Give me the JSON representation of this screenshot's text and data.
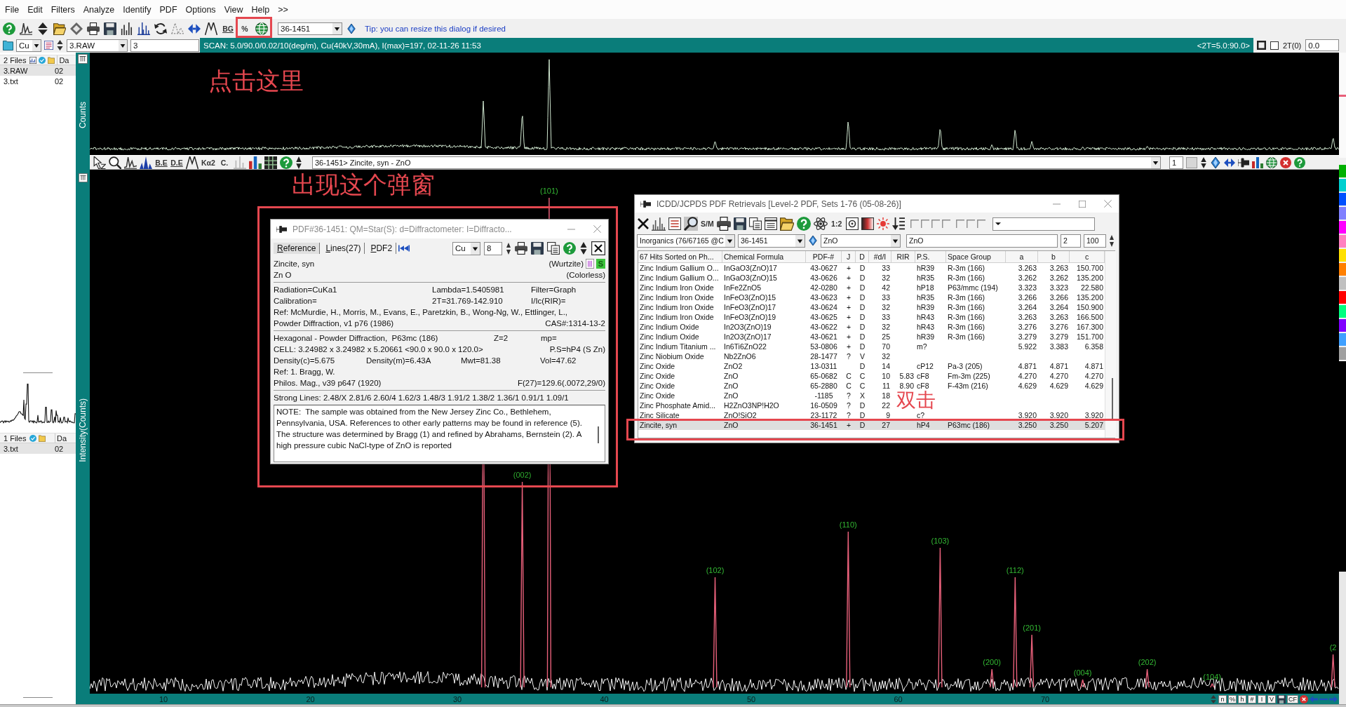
{
  "menu": [
    "File",
    "Edit",
    "Filters",
    "Analyze",
    "Identify",
    "PDF",
    "Options",
    "View",
    "Help",
    ">>"
  ],
  "toolbar": {
    "text_tools": [
      "BG",
      "%"
    ],
    "card_combo": "36-1451",
    "tip": "Tip: you can resize this dialog if desired"
  },
  "scan_bar": {
    "anode": "Cu",
    "file": "3.RAW",
    "field": "3",
    "info": "SCAN: 5.0/90.0/0.02/10(deg/m), Cu(40kV,30mA), I(max)=197, 02-11-26 11:53",
    "range": "<2T=5.0:90.0>",
    "zero_checked": false,
    "zero_label": "2T(0)",
    "zero_value": "0.0"
  },
  "file_panes": [
    {
      "count": "2 Files",
      "column": "Da",
      "files": [
        {
          "name": "3.RAW",
          "date": "02",
          "selected": true
        },
        {
          "name": "3.txt",
          "date": "02",
          "selected": false
        }
      ]
    },
    {
      "count": "1 Files",
      "column": "Da",
      "files": [
        {
          "name": "3.txt",
          "date": "02",
          "selected": true
        }
      ]
    }
  ],
  "plot": {
    "upper_axis": "Counts",
    "lower_axis": "Intensity(Counts)",
    "tool_labels": [
      "B.E",
      "D.E",
      "Kα2",
      "C."
    ],
    "overlay": "36-1451> Zincite, syn - ZnO",
    "overlay_count": "1",
    "peak_labels": [
      "(002)",
      "(101)",
      "(102)",
      "(110)",
      "(103)",
      "(200)",
      "(112)",
      "(201)",
      "(004)",
      "(202)",
      "(104)",
      "(2"
    ],
    "x_ticks": [
      "10",
      "20",
      "30",
      "40",
      "50",
      "60",
      "70"
    ],
    "status_buttons": [
      "n",
      "%",
      "h",
      "#",
      "I",
      "V",
      "CF"
    ]
  },
  "pdf_card": {
    "title": "PDF#36-1451: QM=Star(S): d=Diffractometer: I=Diffracto...",
    "tabs": [
      {
        "label": "Reference",
        "selected": true
      },
      {
        "label": "Lines(27)",
        "selected": false
      },
      {
        "label": "PDF2",
        "selected": false
      }
    ],
    "anode": "Cu",
    "count": "8",
    "name": "Zincite, syn",
    "mineral": "(Wurtzite)",
    "badge": "S",
    "formula": "Zn O",
    "appearance": "(Colorless)",
    "blocks": [
      [
        {
          "kind": "triple",
          "cells": [
            "Radiation=CuKa1",
            "Lambda=1.5405981",
            "Filter=Graph"
          ]
        },
        {
          "kind": "triple",
          "cells": [
            "Calibration=",
            "2T=31.769-142.910",
            "I/Ic(RIR)="
          ]
        },
        {
          "kind": "single",
          "cells": [
            "Ref: McMurdie, H., Morris, M., Evans, E., Paretzkin, B., Wong-Ng, W., Ettlinger, L.,"
          ]
        },
        {
          "kind": "split",
          "cells": [
            "Powder Diffraction, v1 p76 (1986)",
            "CAS#:1314-13-2"
          ]
        }
      ],
      [
        {
          "kind": "hex",
          "cells": [
            "Hexagonal - Powder Diffraction,  P63mc (186)",
            "Z=2",
            "mp="
          ]
        },
        {
          "kind": "split",
          "cells": [
            "CELL: 3.24982 x 3.24982 x 5.20661 <90.0 x 90.0 x 120.0>",
            "P.S=hP4 (S Zn)"
          ]
        },
        {
          "kind": "quad",
          "cells": [
            "Density(c)=5.675",
            "Density(m)=6.43A",
            "Mwt=81.38",
            "Vol=47.62"
          ]
        },
        {
          "kind": "single",
          "cells": [
            "Ref: 1. Bragg, W."
          ]
        },
        {
          "kind": "split",
          "cells": [
            "Philos. Mag., v39 p647 (1920)",
            "F(27)=129.6(.0072,29/0)"
          ]
        }
      ]
    ],
    "strong_lines": "Strong Lines: 2.48/X 2.81/6 2.60/4 1.62/3 1.48/3 1.91/2 1.38/2 1.36/1 0.91/1 1.09/1",
    "note": "NOTE:  The sample was obtained from the New Jersey Zinc Co., Bethlehem, Pennsylvania, USA. References to other early patterns may be found in reference (5). The structure was determined by Bragg (1) and refined by Abrahams, Bernstein (2). A high pressure cubic NaCl-type of ZnO is reported"
  },
  "retrievals": {
    "title": "ICDD/JCPDS PDF Retrievals [Level-2 PDF, Sets 1-76 (05-08-26)]",
    "tool_labels": [
      "S/M",
      "1:2"
    ],
    "search_tool_on": true,
    "database": "Inorganics (76/67165 @C",
    "card": "36-1451",
    "elements": "ZnO",
    "formula": "ZnO",
    "min": "2",
    "max": "100",
    "columns": [
      "67 Hits Sorted on Ph...",
      "Chemical Formula",
      "PDF-#",
      "J",
      "D",
      "#d/I",
      "RIR",
      "P.S.",
      "Space Group",
      "a",
      "b",
      "c"
    ],
    "rows": [
      {
        "name": "Zinc Indium Gallium O...",
        "formula": "InGaO3(ZnO)17",
        "pdf": "43-0627",
        "j": "+",
        "d": "D",
        "lines": "33",
        "ps": "hR39",
        "space_group": "R-3m (166)",
        "a": "3.263",
        "b": "3.263",
        "c": "150.700",
        "selected": false
      },
      {
        "name": "Zinc Indium Gallium O...",
        "formula": "InGaO3(ZnO)15",
        "pdf": "43-0626",
        "j": "+",
        "d": "D",
        "lines": "32",
        "ps": "hR35",
        "space_group": "R-3m (166)",
        "a": "3.262",
        "b": "3.262",
        "c": "135.200",
        "selected": false
      },
      {
        "name": "Zinc Indium Iron Oxide",
        "formula": "InFe2ZnO5",
        "pdf": "42-0280",
        "j": "+",
        "d": "D",
        "lines": "42",
        "ps": "hP18",
        "space_group": "P63/mmc (194)",
        "a": "3.323",
        "b": "3.323",
        "c": "22.580",
        "selected": false
      },
      {
        "name": "Zinc Indium Iron Oxide",
        "formula": "InFeO3(ZnO)15",
        "pdf": "43-0623",
        "j": "+",
        "d": "D",
        "lines": "33",
        "ps": "hR35",
        "space_group": "R-3m (166)",
        "a": "3.266",
        "b": "3.266",
        "c": "135.200",
        "selected": false
      },
      {
        "name": "Zinc Indium Iron Oxide",
        "formula": "InFeO3(ZnO)17",
        "pdf": "43-0624",
        "j": "+",
        "d": "D",
        "lines": "32",
        "ps": "hR39",
        "space_group": "R-3m (166)",
        "a": "3.264",
        "b": "3.264",
        "c": "150.900",
        "selected": false
      },
      {
        "name": "Zinc Indium Iron Oxide",
        "formula": "InFeO3(ZnO)19",
        "pdf": "43-0625",
        "j": "+",
        "d": "D",
        "lines": "33",
        "ps": "hR43",
        "space_group": "R-3m (166)",
        "a": "3.263",
        "b": "3.263",
        "c": "166.500",
        "selected": false
      },
      {
        "name": "Zinc Indium Oxide",
        "formula": "In2O3(ZnO)19",
        "pdf": "43-0622",
        "j": "+",
        "d": "D",
        "lines": "32",
        "ps": "hR43",
        "space_group": "R-3m (166)",
        "a": "3.276",
        "b": "3.276",
        "c": "167.300",
        "selected": false
      },
      {
        "name": "Zinc Indium Oxide",
        "formula": "In2O3(ZnO)17",
        "pdf": "43-0621",
        "j": "+",
        "d": "D",
        "lines": "25",
        "ps": "hR39",
        "space_group": "R-3m (166)",
        "a": "3.279",
        "b": "3.279",
        "c": "151.700",
        "selected": false
      },
      {
        "name": "Zinc Indium Titanium ...",
        "formula": "In6Ti6ZnO22",
        "pdf": "53-0806",
        "j": "+",
        "d": "D",
        "lines": "70",
        "ps": "m?",
        "a": "5.922",
        "b": "3.383",
        "c": "6.358",
        "selected": false
      },
      {
        "name": "Zinc Niobium Oxide",
        "formula": "Nb2ZnO6",
        "pdf": "28-1477",
        "j": "?",
        "d": "V",
        "lines": "32",
        "selected": false
      },
      {
        "name": "Zinc Oxide",
        "formula": "ZnO2",
        "pdf": "13-0311",
        "d": "D",
        "lines": "14",
        "ps": "cP12",
        "space_group": "Pa-3 (205)",
        "a": "4.871",
        "b": "4.871",
        "c": "4.871",
        "selected": false
      },
      {
        "name": "Zinc Oxide",
        "formula": "ZnO",
        "pdf": "65-0682",
        "j": "C",
        "d": "C",
        "lines": "10",
        "rir": "5.83",
        "ps": "cF8",
        "space_group": "Fm-3m (225)",
        "a": "4.270",
        "b": "4.270",
        "c": "4.270",
        "selected": false
      },
      {
        "name": "Zinc Oxide",
        "formula": "ZnO",
        "pdf": "65-2880",
        "j": "C",
        "d": "C",
        "lines": "11",
        "rir": "8.90",
        "ps": "cF8",
        "space_group": "F-43m (216)",
        "a": "4.629",
        "b": "4.629",
        "c": "4.629",
        "selected": false
      },
      {
        "name": "Zinc Oxide",
        "formula": "ZnO",
        "pdf": "-1185",
        "j": "?",
        "d": "X",
        "lines": "18",
        "selected": false
      },
      {
        "name": "Zinc Phosphate Amid...",
        "formula": "H2ZnO3NP!H2O",
        "pdf": "16-0509",
        "j": "?",
        "d": "D",
        "lines": "22",
        "selected": false
      },
      {
        "name": "Zinc Silicate",
        "formula": "ZnO!SiO2",
        "pdf": "23-1172",
        "j": "?",
        "d": "D",
        "lines": "9",
        "ps": "c?",
        "a": "3.920",
        "b": "3.920",
        "c": "3.920",
        "selected": false
      },
      {
        "name": "Zincite, syn",
        "formula": "ZnO",
        "pdf": "36-1451",
        "j": "+",
        "d": "D",
        "lines": "27",
        "ps": "hP4",
        "space_group": "P63mc (186)",
        "a": "3.250",
        "b": "3.250",
        "c": "5.207",
        "selected": true
      }
    ]
  },
  "annotations": [
    "点击这里",
    "出现这个弹窗",
    "双击"
  ]
}
